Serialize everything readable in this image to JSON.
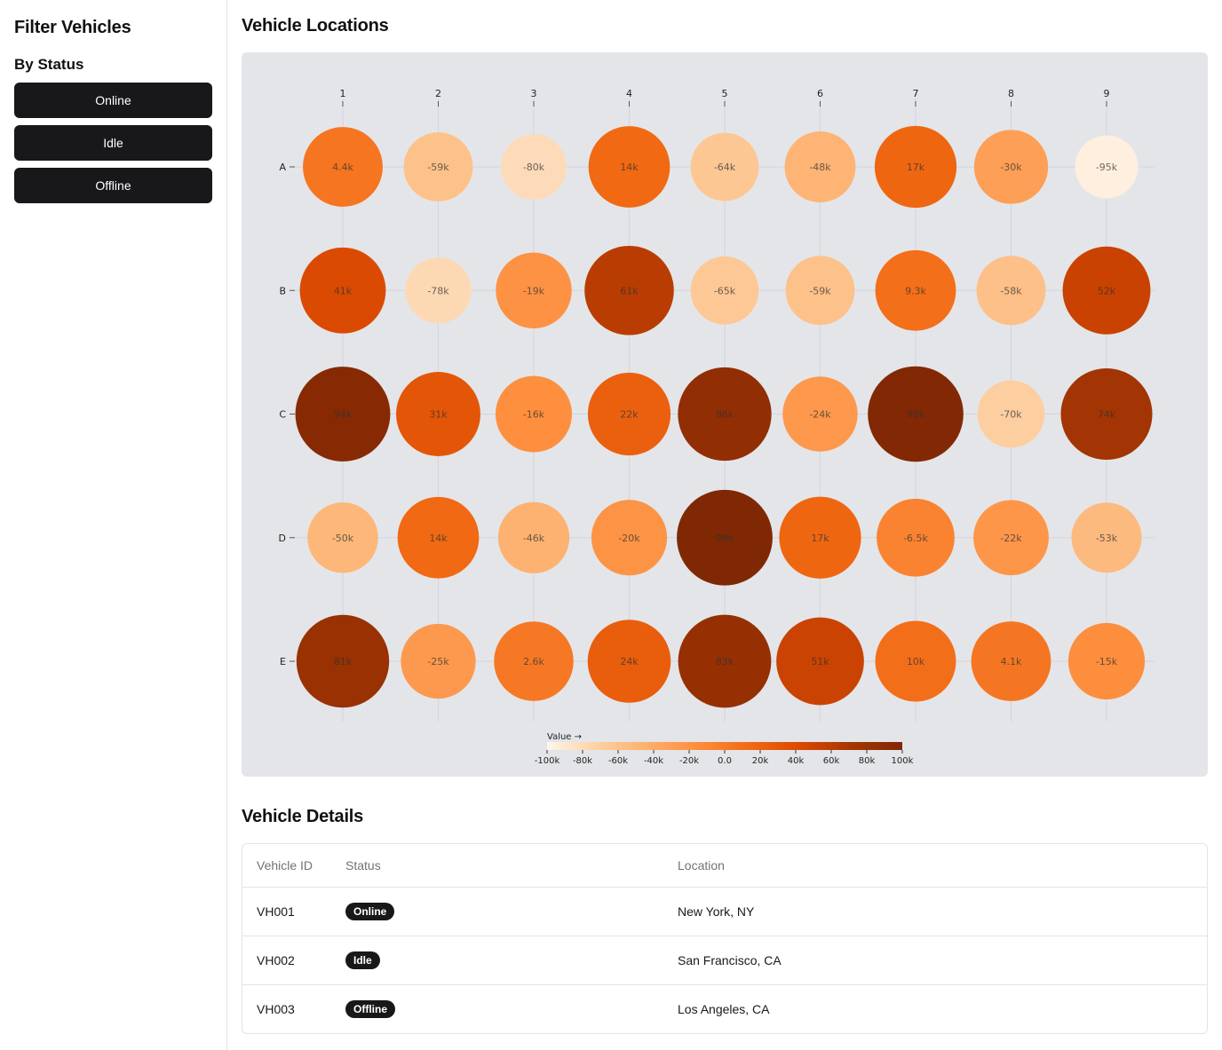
{
  "sidebar": {
    "title": "Filter Vehicles",
    "status_heading": "By Status",
    "buttons": [
      "Online",
      "Idle",
      "Offline"
    ]
  },
  "main": {
    "locations_title": "Vehicle Locations",
    "details_title": "Vehicle Details"
  },
  "chart_data": {
    "type": "heatmap",
    "title": "",
    "columns": [
      "1",
      "2",
      "3",
      "4",
      "5",
      "6",
      "7",
      "8",
      "9"
    ],
    "rows": [
      "A",
      "B",
      "C",
      "D",
      "E"
    ],
    "values": [
      [
        4400,
        -59000,
        -80000,
        14000,
        -64000,
        -48000,
        17000,
        -30000,
        -95000
      ],
      [
        41000,
        -78000,
        -19000,
        61000,
        -65000,
        -59000,
        9300,
        -58000,
        52000
      ],
      [
        94000,
        31000,
        -16000,
        22000,
        86000,
        -24000,
        98000,
        -70000,
        74000
      ],
      [
        -50000,
        14000,
        -46000,
        -20000,
        99000,
        17000,
        -6500,
        -22000,
        -53000
      ],
      [
        81000,
        -25000,
        2600,
        24000,
        83000,
        51000,
        10000,
        4100,
        -15000
      ]
    ],
    "labels": [
      [
        "4.4k",
        "-59k",
        "-80k",
        "14k",
        "-64k",
        "-48k",
        "17k",
        "-30k",
        "-95k"
      ],
      [
        "41k",
        "-78k",
        "-19k",
        "61k",
        "-65k",
        "-59k",
        "9.3k",
        "-58k",
        "52k"
      ],
      [
        "94k",
        "31k",
        "-16k",
        "22k",
        "86k",
        "-24k",
        "98k",
        "-70k",
        "74k"
      ],
      [
        "-50k",
        "14k",
        "-46k",
        "-20k",
        "99k",
        "17k",
        "-6.5k",
        "-22k",
        "-53k"
      ],
      [
        "81k",
        "-25k",
        "2.6k",
        "24k",
        "83k",
        "51k",
        "10k",
        "4.1k",
        "-15k"
      ]
    ],
    "legend": {
      "title": "Value →",
      "domain": [
        -100000,
        100000
      ],
      "ticks": [
        "-100k",
        "-80k",
        "-60k",
        "-40k",
        "-20k",
        "0.0",
        "20k",
        "40k",
        "60k",
        "80k",
        "100k"
      ],
      "colors": [
        "#fff5eb",
        "#fdd0a2",
        "#fdae6b",
        "#fd8d3c",
        "#f16913",
        "#d94801",
        "#a63603",
        "#7f2704"
      ]
    },
    "grid": true
  },
  "table": {
    "headers": [
      "Vehicle ID",
      "Status",
      "Location"
    ],
    "rows": [
      {
        "id": "VH001",
        "status": "Online",
        "location": "New York, NY"
      },
      {
        "id": "VH002",
        "status": "Idle",
        "location": "San Francisco, CA"
      },
      {
        "id": "VH003",
        "status": "Offline",
        "location": "Los Angeles, CA"
      }
    ]
  }
}
